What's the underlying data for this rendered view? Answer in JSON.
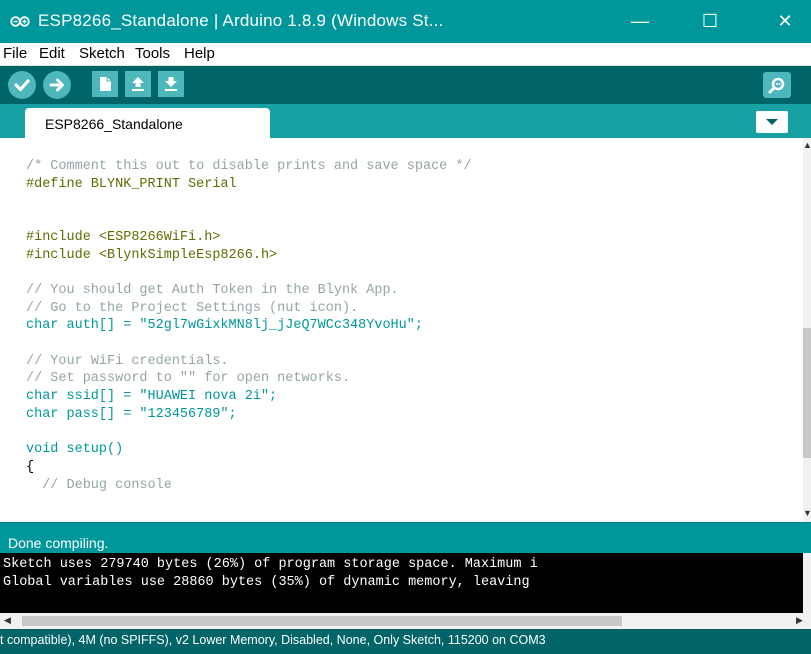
{
  "window": {
    "title": "ESP8266_Standalone | Arduino 1.8.9 (Windows St...",
    "minimize_glyph": "—",
    "maximize_glyph": "☐",
    "close_glyph": "✕"
  },
  "menu": [
    "File",
    "Edit",
    "Sketch",
    "Tools",
    "Help"
  ],
  "toolbar": {
    "buttons": [
      "verify-icon",
      "upload-icon",
      "new-icon",
      "open-icon",
      "save-icon"
    ],
    "serial_monitor_icon": "serial-monitor-icon"
  },
  "tabs": [
    {
      "label": "ESP8266_Standalone"
    }
  ],
  "editor": {
    "lines": [
      "/* Comment this out to disable prints and save space */",
      "#define BLYNK_PRINT Serial",
      "",
      "",
      "#include <ESP8266WiFi.h>",
      "#include <BlynkSimpleEsp8266.h>",
      "",
      "// You should get Auth Token in the Blynk App.",
      "// Go to the Project Settings (nut icon).",
      "char auth[] = \"52gl7wGixkMN8lj_jJeQ7WCc348YvoHu\";",
      "",
      "// Your WiFi credentials.",
      "// Set password to \"\" for open networks.",
      "char ssid[] = \"HUAWEI nova 2i\";",
      "char pass[] = \"123456789\";",
      "",
      "void setup()",
      "{",
      "  // Debug console"
    ]
  },
  "status": "Done compiling.",
  "console": [
    "Sketch uses 279740 bytes (26%) of program storage space. Maximum i",
    "Global variables use 28860 bytes (35%) of dynamic memory, leaving"
  ],
  "board_status": "t compatible), 4M (no SPIFFS), v2 Lower Memory, Disabled, None, Only Sketch, 115200 on COM3",
  "colors": {
    "title_bar": "#00979C",
    "toolbar": "#006468",
    "tab_strip": "#17A1A5",
    "button": "#4DB7BB",
    "comment": "#95A5A6",
    "keyword": "#00979C",
    "preprocessor": "#5E6D03",
    "literal": "#D35400"
  }
}
